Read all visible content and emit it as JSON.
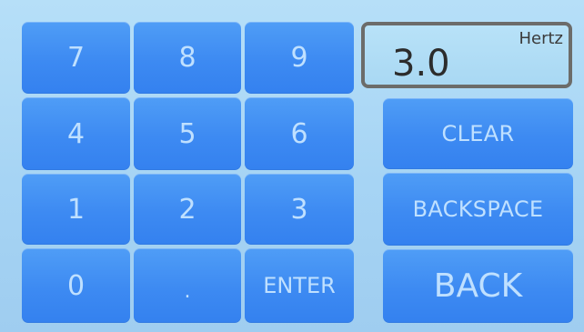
{
  "keypad": {
    "k7": "7",
    "k8": "8",
    "k9": "9",
    "k4": "4",
    "k5": "5",
    "k6": "6",
    "k1": "1",
    "k2": "2",
    "k3": "3",
    "k0": "0",
    "decimal": ".",
    "enter": "ENTER"
  },
  "display": {
    "value": "3.0",
    "unit": "Hertz"
  },
  "actions": {
    "clear": "CLEAR",
    "backspace": "BACKSPACE",
    "back": "BACK"
  },
  "colors": {
    "key_blue": "#3d8af2",
    "key_text": "#bfe0ff",
    "background": "#a9d7f7",
    "display_border": "#6c6c6a"
  }
}
